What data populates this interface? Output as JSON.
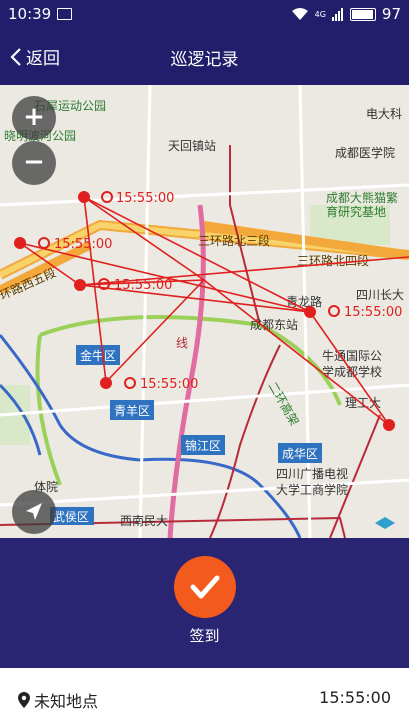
{
  "status_bar": {
    "time": "10:39",
    "battery": "97",
    "network": "4G"
  },
  "header": {
    "back_label": "返回",
    "title": "巡逻记录"
  },
  "zoom": {
    "in_label": "+",
    "out_label": "−"
  },
  "map": {
    "labels": {
      "l1": "石犀运动公园",
      "l2": "晓明波河公园",
      "l3": "天回镇站",
      "l4": "电大科",
      "l5": "成都医学院",
      "l6": "成都大熊猫繁",
      "l7": "育研究基地",
      "l8": "三环路北三段",
      "l9": "三环路北四段",
      "l10": "环路西五段",
      "l11": "青龙路",
      "l12": "四川长大",
      "l13": "成都东站",
      "l14": "金牛区",
      "l15": "牛通国际公",
      "l16": "学成都学校",
      "l17": "青羊区",
      "l18": "理工大",
      "l19": "锦江区",
      "l20": "成华区",
      "l21": "四川广播电视",
      "l22": "大学工商学院",
      "l23": "武侯区",
      "l24": "西南民大",
      "l25": "体院",
      "l26": "线",
      "l27": "二环高架"
    },
    "markers": [
      {
        "time": "15:55:00"
      },
      {
        "time": "15:55:00"
      },
      {
        "time": "15:55:00"
      },
      {
        "time": "15:55:00"
      },
      {
        "time": "15:55:00"
      }
    ]
  },
  "checkin": {
    "label": "签到"
  },
  "footer": {
    "location": "未知地点",
    "time": "15:55:00"
  },
  "colors": {
    "header": "#221e6b",
    "bottom": "#2a2572",
    "accent": "#f25a1e",
    "route": "#e0201e"
  }
}
